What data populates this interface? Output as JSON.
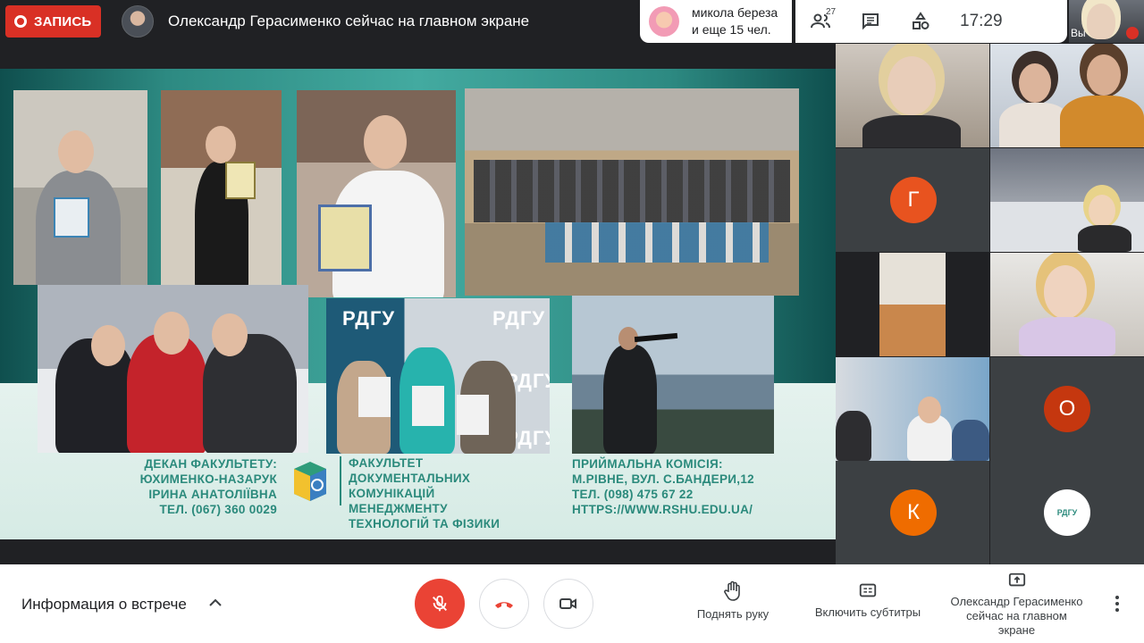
{
  "top": {
    "record_label": "ЗАПИСЬ",
    "presenter_title": "Олександр Герасименко сейчас на главном экране",
    "notification": {
      "line1": "микола береза",
      "line2": "и еще 15 чел."
    },
    "participants_count": "27",
    "time": "17:29",
    "self_label": "Вы"
  },
  "slide": {
    "dean_lines": [
      "ДЕКАН ФАКУЛЬТЕТУ:",
      "ЮХИМЕНКО-НАЗАРУК",
      "ІРИНА АНАТОЛІЇВНА",
      "ТЕЛ. (067) 360 0029"
    ],
    "faculty_lines": [
      "ФАКУЛЬТЕТ",
      "ДОКУМЕНТАЛЬНИХ КОМУНІКАЦІЙ",
      "МЕНЕДЖМЕНТУ",
      "ТЕХНОЛОГІЙ ТА ФІЗИКИ"
    ],
    "admission_lines": [
      "ПРИЙМАЛЬНА КОМІСІЯ:",
      "М.РІВНЕ, ВУЛ. С.БАНДЕРИ,12",
      "ТЕЛ. (098) 475 67 22",
      "HTTPS://WWW.RSHU.EDU.UA/"
    ],
    "photo_tags": {
      "tag1": "РДГУ",
      "tag2": "РДГУ",
      "tag3": "РДГУ",
      "tag4": "РДГУ"
    }
  },
  "tiles": {
    "g_initial": "Г",
    "o_initial": "О",
    "k_initial": "К",
    "logo_text": "РДГУ"
  },
  "colors": {
    "g": "#e8531f",
    "o": "#c5370f",
    "k": "#ef6c00"
  },
  "bottom": {
    "meeting_info": "Информация о встрече",
    "raise_hand": "Поднять руку",
    "captions": "Включить субтитры",
    "presenting_lines": [
      "Олександр Герасименко",
      "сейчас на главном",
      "экране"
    ]
  }
}
